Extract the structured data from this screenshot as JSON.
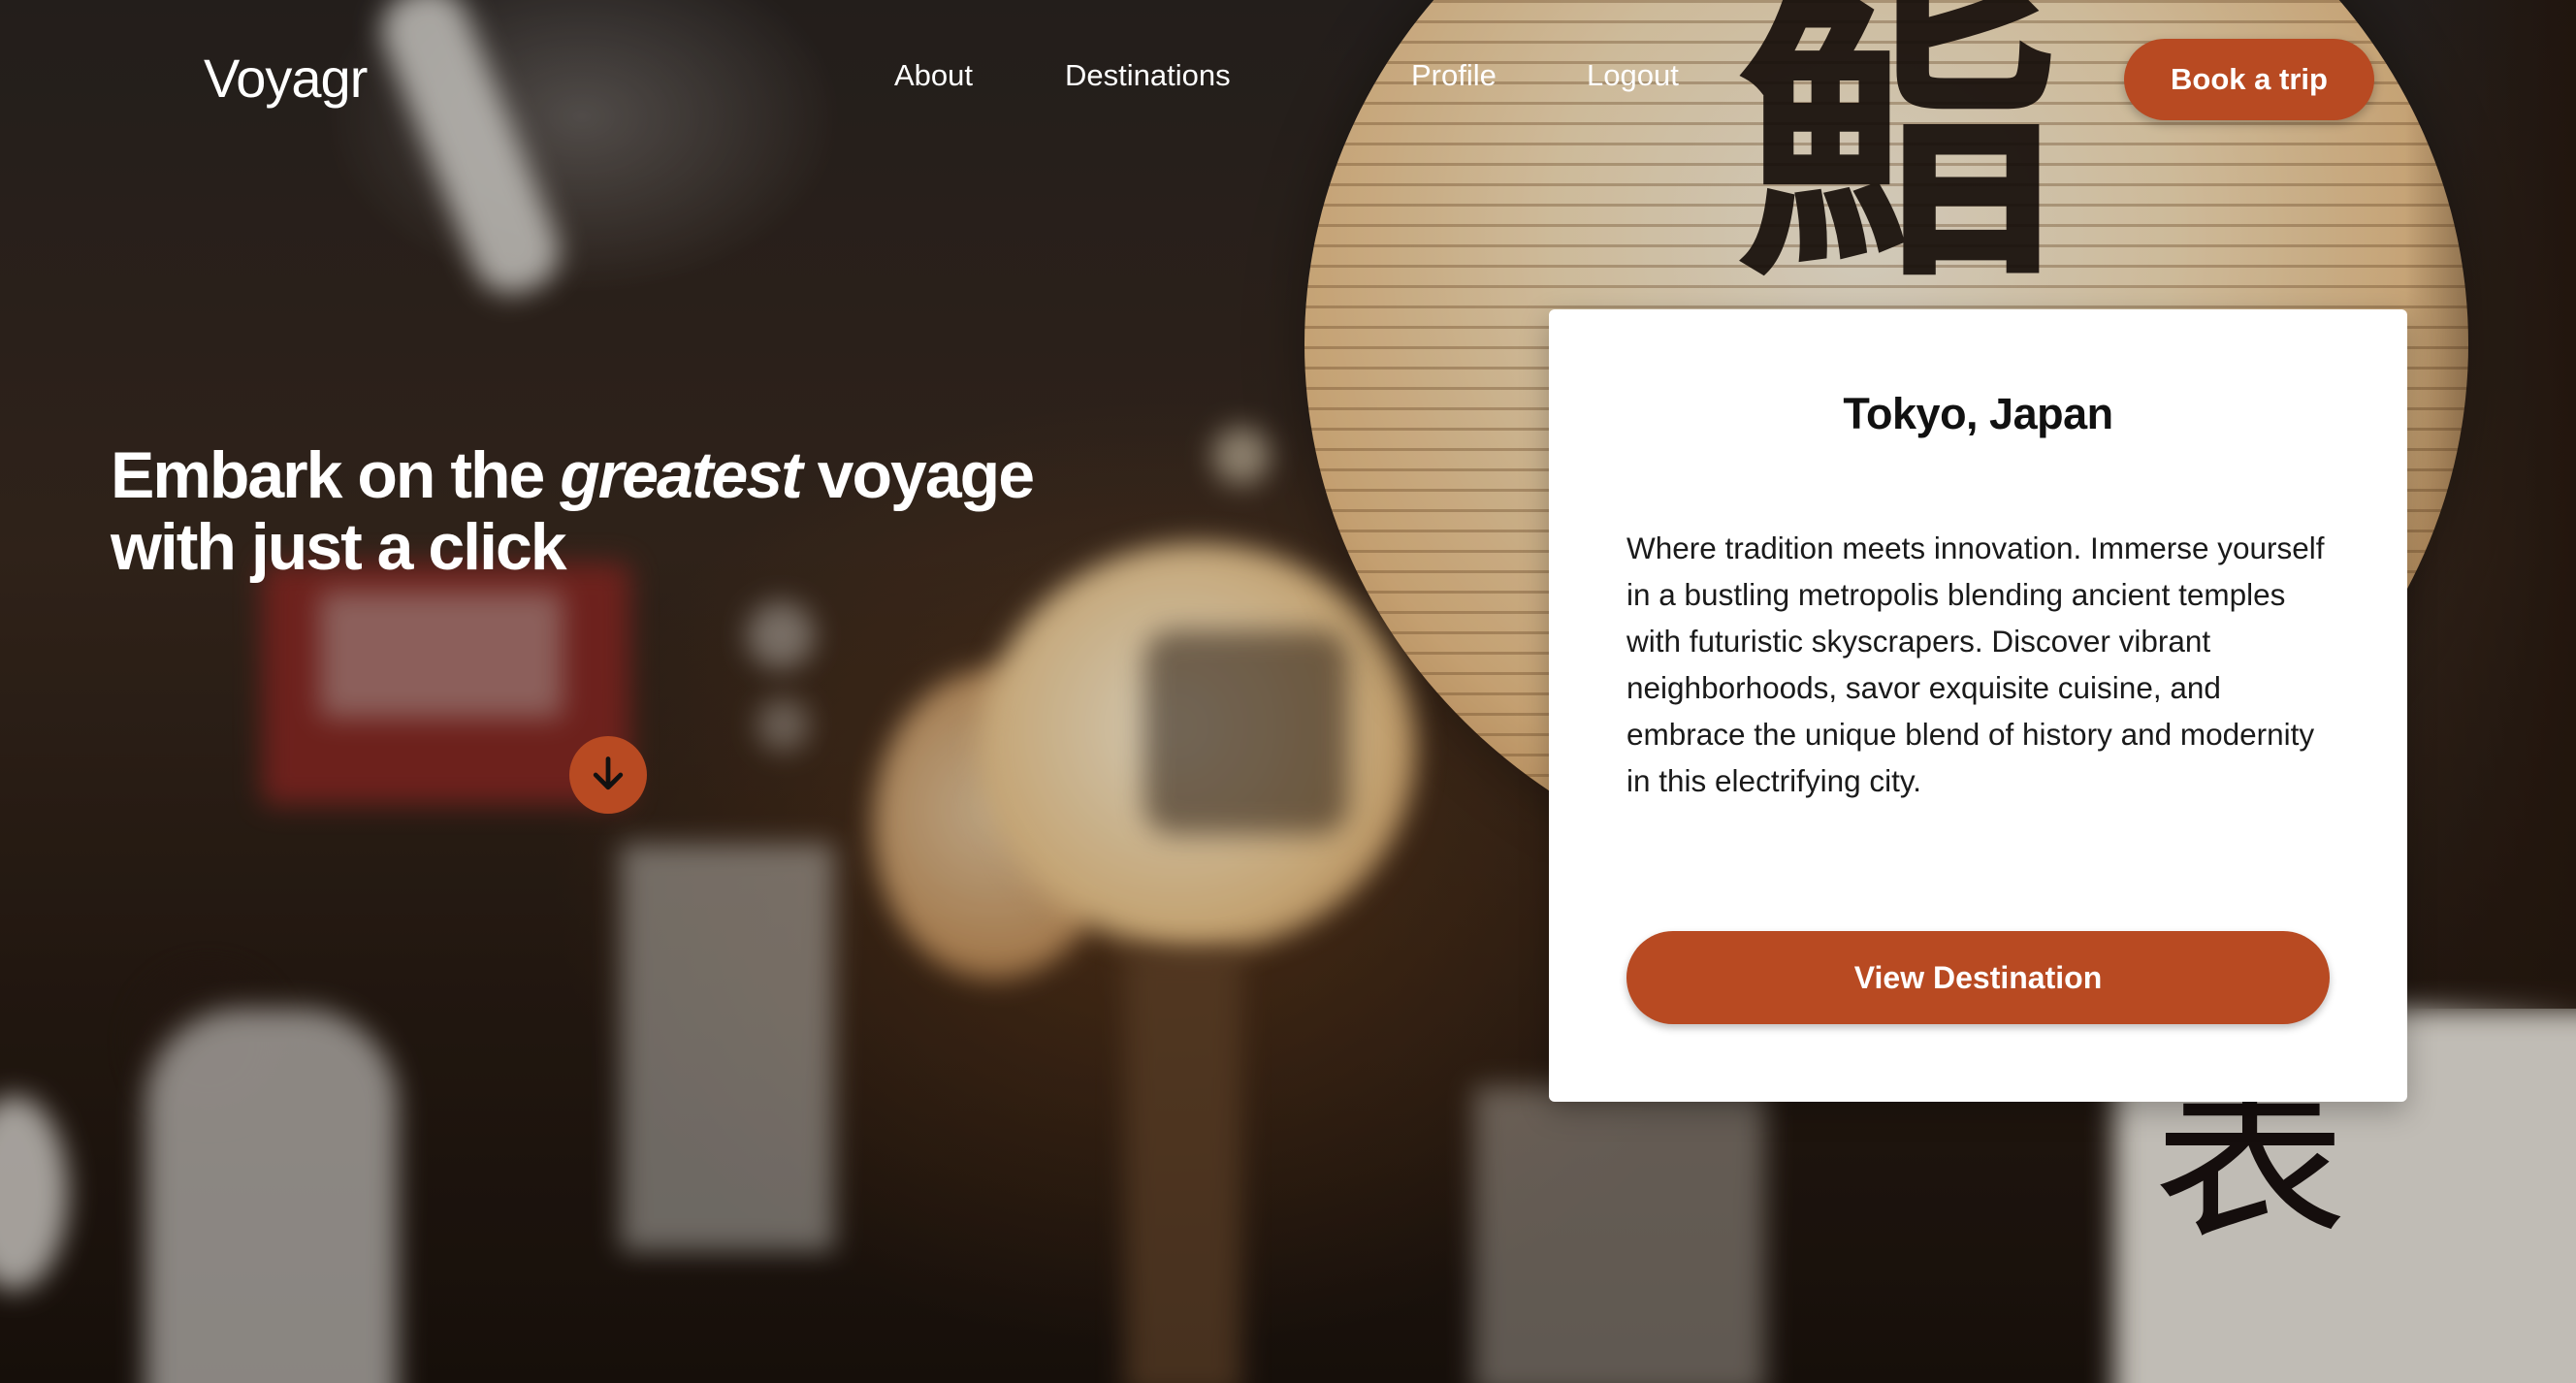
{
  "header": {
    "logo": "Voyagr",
    "nav": {
      "about": "About",
      "destinations": "Destinations",
      "profile": "Profile",
      "logout": "Logout"
    },
    "cta_label": "Book a trip"
  },
  "hero": {
    "line1_before": "Embark on the ",
    "line1_emphasis": "greatest",
    "line1_after": " voyage",
    "line2": "with just a click",
    "scroll_icon": "arrow-down-icon"
  },
  "destination_card": {
    "title": "Tokyo, Japan",
    "description": "Where tradition meets innovation. Immerse yourself in a bustling metropolis blending ancient temples with futuristic skyscrapers. Discover vibrant neighborhoods, savor exquisite cuisine, and embrace the unique blend of history and modernity in this electrifying city.",
    "button_label": "View Destination"
  },
  "colors": {
    "accent": "#b84a22",
    "card_background": "#ffffff",
    "text_on_dark": "#ffffff",
    "card_text": "#1a1a1a"
  }
}
